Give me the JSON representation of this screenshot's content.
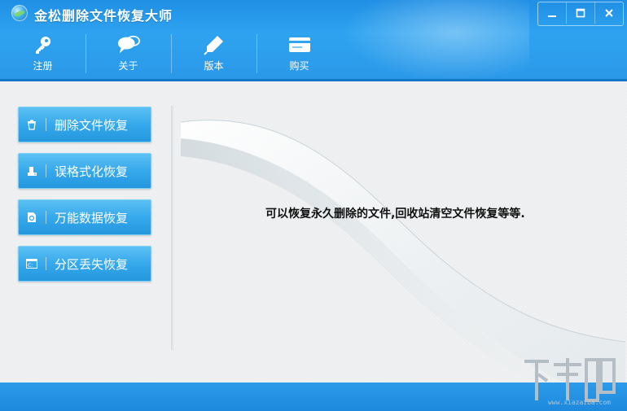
{
  "window": {
    "title": "金松删除文件恢复大师"
  },
  "toolbar": {
    "items": [
      {
        "label": "注册",
        "icon": "key-icon"
      },
      {
        "label": "关于",
        "icon": "chat-bubbles-icon"
      },
      {
        "label": "版本",
        "icon": "pencil-icon"
      },
      {
        "label": "购买",
        "icon": "card-icon"
      }
    ]
  },
  "sidebar": {
    "items": [
      {
        "label": "删除文件恢复",
        "icon": "trash-icon"
      },
      {
        "label": "误格式化恢复",
        "icon": "format-drive-icon"
      },
      {
        "label": "万能数据恢复",
        "icon": "data-file-icon"
      },
      {
        "label": "分区丢失恢复",
        "icon": "partition-icon"
      }
    ]
  },
  "main": {
    "info_text": "可以恢复永久删除的文件,回收站清空文件恢复等等."
  },
  "watermark": {
    "url": "www.xiazaiba.com"
  },
  "colors": {
    "accent": "#2ea3f0",
    "button": "#36a9ec",
    "footer": "#2493e2"
  }
}
